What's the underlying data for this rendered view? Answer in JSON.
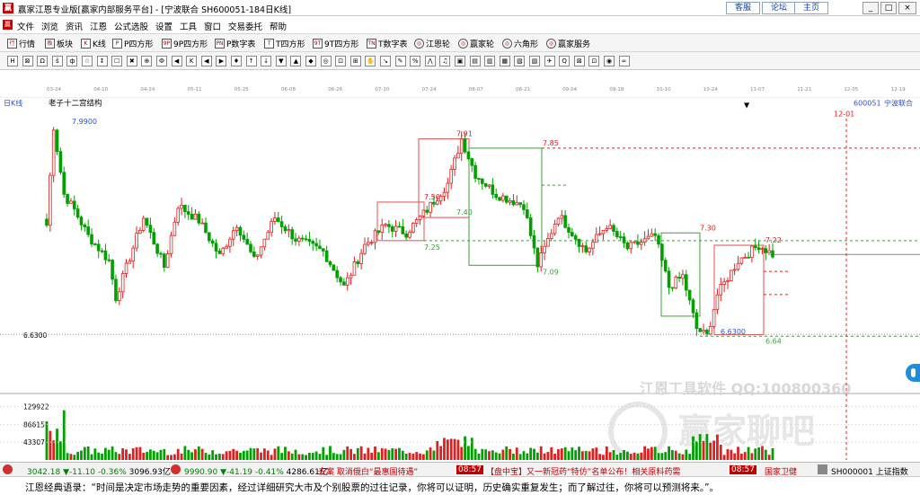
{
  "titlebar": {
    "logo": "赢",
    "title": "赢家江恩专业版[赢家内部服务平台] - [宁波联合  SH600051-184日K线]",
    "links": [
      "客服",
      "论坛",
      "主页"
    ],
    "win_min": "_",
    "win_max": "□",
    "win_close": "×"
  },
  "menu": {
    "logo": "赢",
    "items": [
      "文件",
      "浏览",
      "资讯",
      "江恩",
      "公式选股",
      "设置",
      "工具",
      "窗口",
      "交易委托",
      "帮助"
    ]
  },
  "toolbar1": {
    "items": [
      {
        "icon": "行",
        "label": "行情"
      },
      {
        "icon": "板",
        "label": "板块"
      },
      {
        "icon": "K",
        "label": "K线"
      },
      {
        "icon": "P",
        "label": "P四方形"
      },
      {
        "icon": "9P",
        "label": "9P四方形"
      },
      {
        "icon": "PN",
        "label": "P数字表"
      },
      {
        "icon": "T",
        "label": "T四方形"
      },
      {
        "icon": "9T",
        "label": "9T四方形"
      },
      {
        "icon": "TN",
        "label": "T数字表"
      },
      {
        "icon": "◎",
        "label": "江恩轮"
      },
      {
        "icon": "◎",
        "label": "赢家轮"
      },
      {
        "icon": "◎",
        "label": "六角形"
      },
      {
        "icon": "◎",
        "label": "赢家服务"
      }
    ]
  },
  "toolbar2": {
    "icons": [
      "H",
      "⊠",
      "Ω",
      "ŝ",
      "ф",
      "☆",
      "↕",
      "☐",
      "✖",
      "⊕",
      "Ф",
      "◀",
      "K",
      "◀",
      "▶",
      "♦",
      "↑",
      "↓",
      "▼",
      "▲",
      "◆",
      "◎",
      "⊡",
      "⊞",
      "✋",
      "↘",
      "✎",
      "%",
      "⋀",
      "♫",
      "▣",
      "▤",
      "▥",
      "▦",
      "▧",
      "▨",
      "✈",
      "Q",
      "⊠",
      "⊡",
      "◉",
      "∞"
    ]
  },
  "datebar": {
    "dates": [
      "03-24",
      "04-10",
      "04-24",
      "05-11",
      "05-25",
      "06-08",
      "06-26",
      "07-10",
      "07-24",
      "08-07",
      "08-21",
      "09-04",
      "09-18",
      "10-10",
      "10-24",
      "11-07",
      "11-21",
      "12-05",
      "12-19"
    ]
  },
  "chart_header": {
    "period_label": "日K线",
    "study_name": "老子十二宫结构",
    "stock_code": "600051",
    "stock_name": "宁波联合",
    "date_marker": "12-01"
  },
  "chart_data": {
    "type": "candlestick",
    "price_ylim": [
      6.2,
      8.1
    ],
    "volume_ylim": [
      0,
      140000
    ],
    "price_axis_label": "6.6300",
    "volume_ticks": [
      "129922",
      "86615",
      "43307"
    ],
    "annotations": [
      {
        "label": "7.9900",
        "price": 7.99
      },
      {
        "label": "7.91",
        "price": 7.91
      },
      {
        "label": "7.85",
        "price": 7.85
      },
      {
        "label": "7.50",
        "price": 7.5
      },
      {
        "label": "7.40",
        "price": 7.4
      },
      {
        "label": "7.30",
        "price": 7.3
      },
      {
        "label": "7.25",
        "price": 7.25
      },
      {
        "label": "7.22",
        "price": 7.22
      },
      {
        "label": "7.09",
        "price": 7.09
      },
      {
        "label": "6.6300",
        "price": 6.63
      },
      {
        "label": "6.64",
        "price": 6.64
      }
    ],
    "colors": {
      "up": "#e02020",
      "down": "#00a000",
      "box_red": "#e05050",
      "box_green": "#3aa03a",
      "label": "#3050d0"
    }
  },
  "watermark": {
    "line1": "江恩工具软件  QQ:100800360",
    "line2": "赢家聊吧"
  },
  "statusbar": {
    "idx1_value": "3042.18",
    "idx1_change": "▼-11.10",
    "idx1_pct": "-0.36%",
    "idx1_amount": "3096.93亿",
    "idx2_value": "9990.90",
    "idx2_change": "▼-41.19",
    "idx2_pct": "-0.41%",
    "idx2_amount": "4286.61亿",
    "news1": "去案 取消俄白“最惠国待遇”",
    "time1": "08:57",
    "news2": "【盘中宝】又一新冠药“特仿”名单公布！相关原料药需",
    "time2": "08:57",
    "news3": "国家卫健",
    "stock": "SH000001 上证指数"
  },
  "quote": {
    "text": "江恩经典语录：“时间是决定市场走势的重要因素，经过详细研究大市及个别股票的过往记录，你将可以证明，历史确实重复发生；而了解过往，你将可以预测将来。”。"
  }
}
